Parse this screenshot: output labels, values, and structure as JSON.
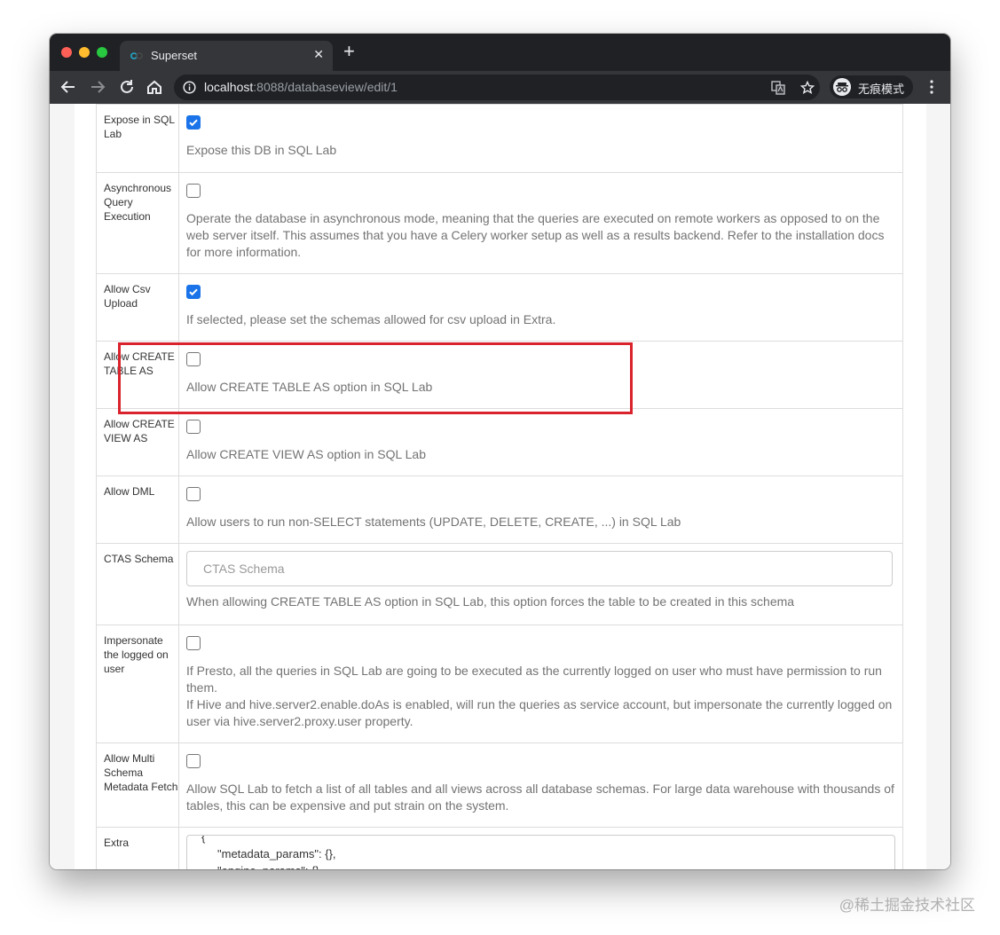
{
  "browser": {
    "tab_title": "Superset",
    "url_host": "localhost",
    "url_rest": ":8088/databaseview/edit/1",
    "profile_label": "无痕模式",
    "accent": "#1a73e8"
  },
  "form": {
    "expose_sql_lab": {
      "label": "Expose in SQL Lab",
      "checked": true,
      "help": "Expose this DB in SQL Lab"
    },
    "async_query": {
      "label": "Asynchronous Query Execution",
      "checked": false,
      "help": "Operate the database in asynchronous mode, meaning that the queries are executed on remote workers as opposed to on the web server itself. This assumes that you have a Celery worker setup as well as a results backend. Refer to the installation docs for more information."
    },
    "allow_csv": {
      "label": "Allow Csv Upload",
      "checked": true,
      "help": "If selected, please set the schemas allowed for csv upload in Extra."
    },
    "allow_ctas": {
      "label": "Allow CREATE TABLE AS",
      "checked": false,
      "help": "Allow CREATE TABLE AS option in SQL Lab"
    },
    "allow_cvas": {
      "label": "Allow CREATE VIEW AS",
      "checked": false,
      "help": "Allow CREATE VIEW AS option in SQL Lab"
    },
    "allow_dml": {
      "label": "Allow DML",
      "checked": false,
      "help": "Allow users to run non-SELECT statements (UPDATE, DELETE, CREATE, ...) in SQL Lab"
    },
    "ctas_schema": {
      "label": "CTAS Schema",
      "placeholder": "CTAS Schema",
      "help": "When allowing CREATE TABLE AS option in SQL Lab, this option forces the table to be created in this schema"
    },
    "impersonate": {
      "label": "Impersonate the logged on user",
      "checked": false,
      "help_1": "If Presto, all the queries in SQL Lab are going to be executed as the currently logged on user who must have permission to run them.",
      "help_2": "If Hive and hive.server2.enable.doAs is enabled, will run the queries as service account, but impersonate the currently logged on user via hive.server2.proxy.user property."
    },
    "multi_schema": {
      "label": "Allow Multi Schema Metadata Fetch",
      "checked": false,
      "help": "Allow SQL Lab to fetch a list of all tables and all views across all database schemas. For large data warehouse with thousands of tables, this can be expensive and put strain on the system."
    },
    "extra": {
      "label": "Extra",
      "line_1": "{",
      "line_2": "\"metadata_params\": {},",
      "line_3": "\"engine_params\": {},"
    }
  },
  "annotation": {
    "highlight_color": "#d9232d"
  },
  "watermark": "@稀土掘金技术社区"
}
